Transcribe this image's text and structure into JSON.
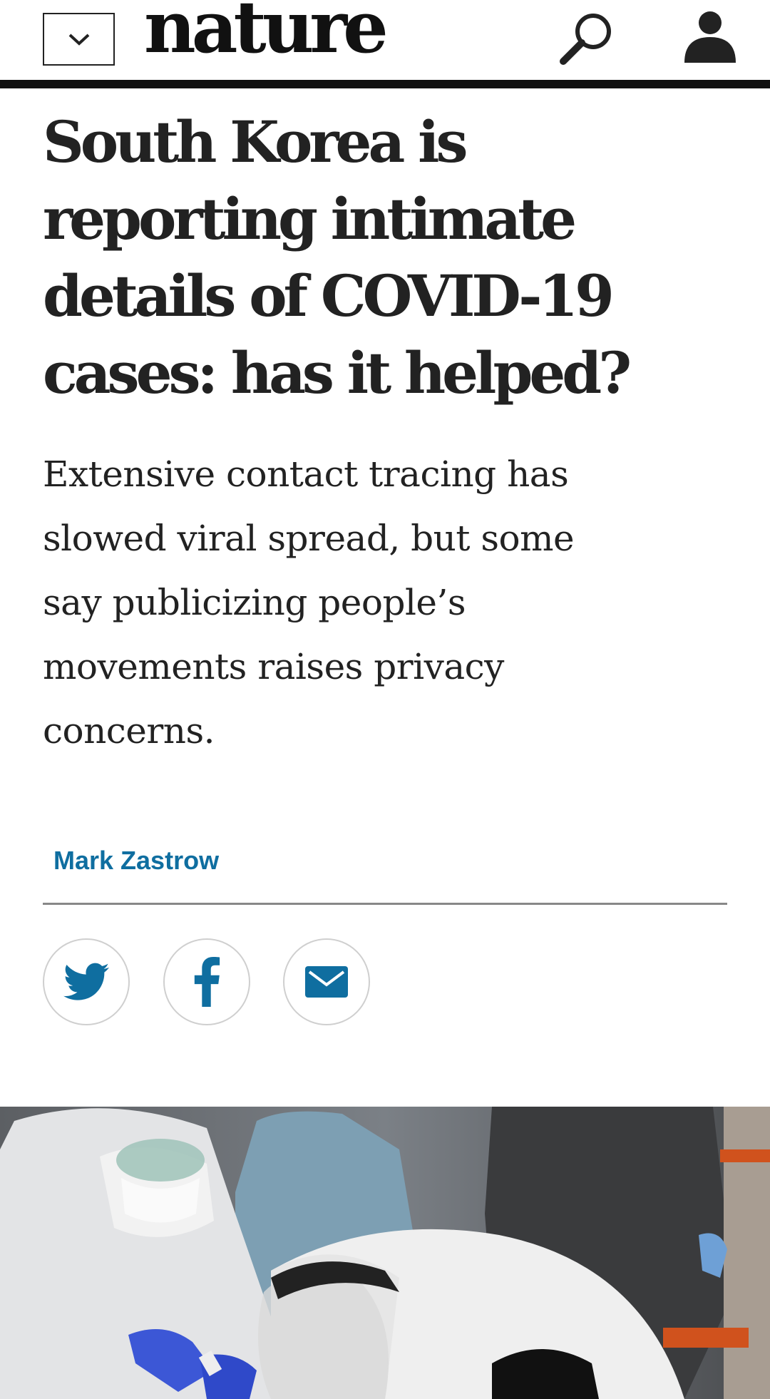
{
  "header": {
    "logo": "nature",
    "menu_icon": "chevron-down-icon",
    "search_icon": "search-icon",
    "account_icon": "user-icon"
  },
  "article": {
    "headline": "South Korea is reporting intimate details of COVID-19 cases: has it helped?",
    "standfirst": "Extensive contact tracing has slowed viral spread, but some say publicizing people’s movements raises privacy concerns.",
    "author": "Mark Zastrow"
  },
  "share": [
    {
      "icon": "twitter-icon"
    },
    {
      "icon": "facebook-icon"
    },
    {
      "icon": "email-icon"
    }
  ],
  "colors": {
    "brand_blue": "#0f6ea0",
    "text": "#222222",
    "rule": "#111111"
  }
}
